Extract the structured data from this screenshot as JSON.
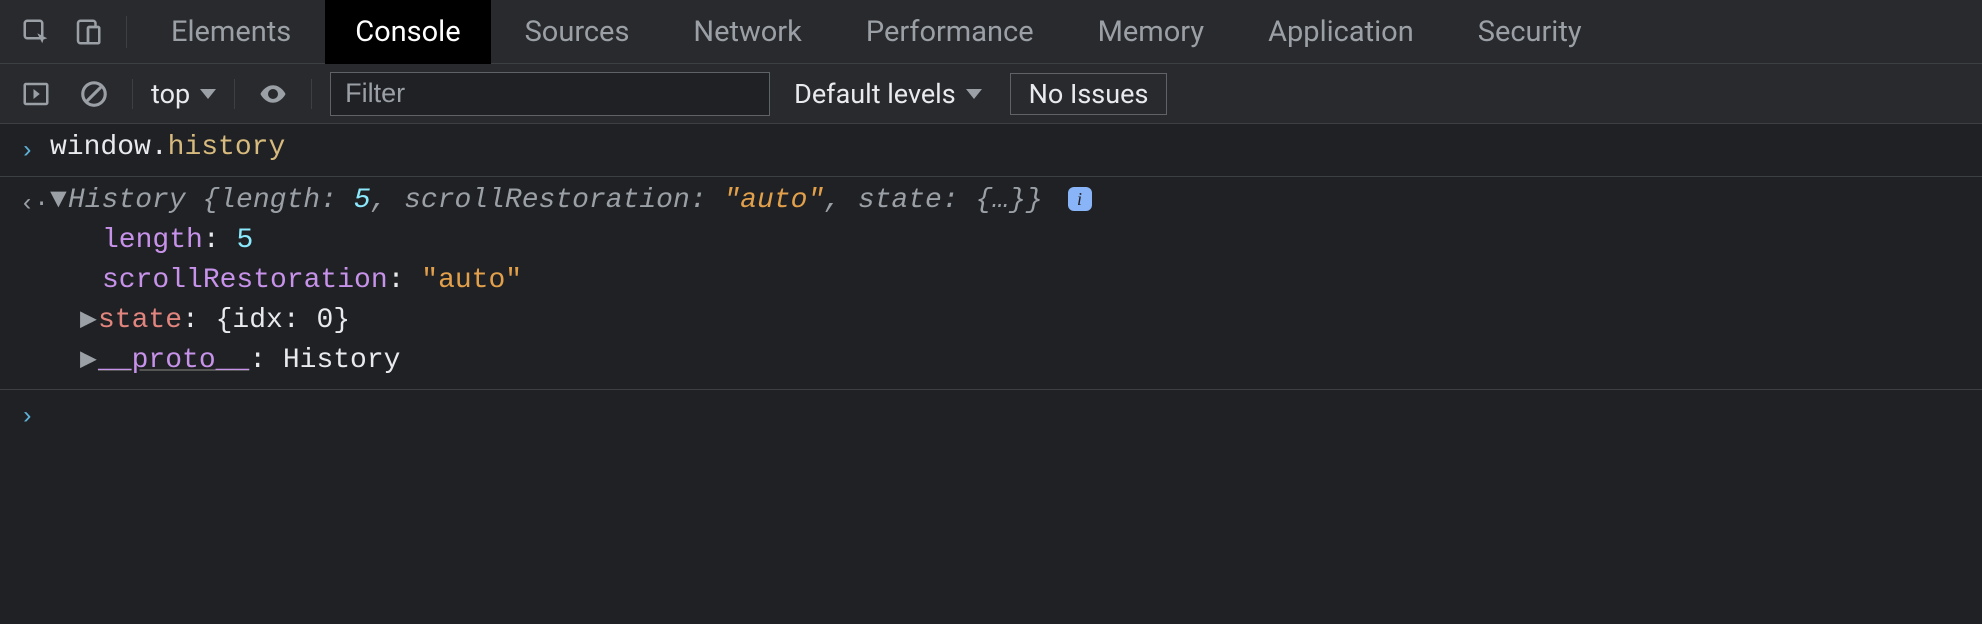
{
  "tabs": {
    "elements": "Elements",
    "console": "Console",
    "sources": "Sources",
    "network": "Network",
    "performance": "Performance",
    "memory": "Memory",
    "application": "Application",
    "security": "Security"
  },
  "toolbar": {
    "context": "top",
    "filter_placeholder": "Filter",
    "levels": "Default levels",
    "issues": "No Issues"
  },
  "console": {
    "input_line": {
      "object": "window",
      "dot": ".",
      "prop": "history"
    },
    "output": {
      "summary": {
        "class": "History",
        "length_key": "length:",
        "length_val": "5",
        "scroll_key": "scrollRestoration:",
        "scroll_val": "\"auto\"",
        "state_key": "state:",
        "state_val": "{…}"
      },
      "props": {
        "length_key": "length",
        "length_val": "5",
        "scroll_key": "scrollRestoration",
        "scroll_val": "\"auto\"",
        "state_key": "state",
        "state_val": "{idx: 0}",
        "proto_key": "__proto__",
        "proto_val": "History"
      }
    }
  }
}
